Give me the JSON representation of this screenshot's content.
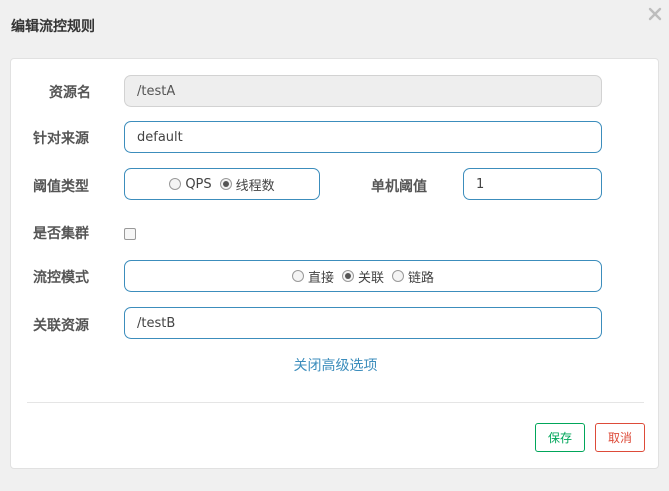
{
  "dialog": {
    "title": "编辑流控规则"
  },
  "form": {
    "resource_name": {
      "label": "资源名",
      "value": "/testA"
    },
    "limit_app": {
      "label": "针对来源",
      "value": "default"
    },
    "threshold_type": {
      "label": "阈值类型",
      "options": [
        {
          "label": "QPS",
          "selected": false
        },
        {
          "label": "线程数",
          "selected": true
        }
      ]
    },
    "single_threshold": {
      "label": "单机阈值",
      "value": "1"
    },
    "cluster_mode": {
      "label": "是否集群",
      "checked": false
    },
    "control_mode": {
      "label": "流控模式",
      "options": [
        {
          "label": "直接",
          "selected": false
        },
        {
          "label": "关联",
          "selected": true
        },
        {
          "label": "链路",
          "selected": false
        }
      ]
    },
    "ref_resource": {
      "label": "关联资源",
      "value": "/testB"
    },
    "advanced_link": "关闭高级选项"
  },
  "footer": {
    "save_label": "保存",
    "cancel_label": "取消"
  },
  "icons": {
    "close": "close-icon"
  },
  "colors": {
    "accent": "#3c8dbc",
    "save": "#00a65a",
    "cancel": "#dd4b39"
  }
}
